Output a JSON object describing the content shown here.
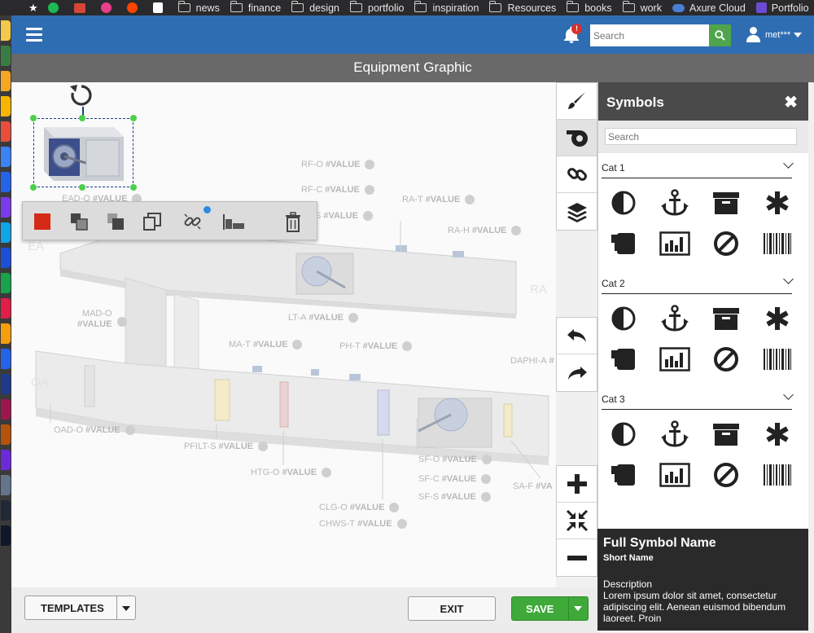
{
  "bookmarks": [
    {
      "label": "",
      "icon": "spotify-icon",
      "color": "#1db954"
    },
    {
      "label": "",
      "icon": "gmail-icon",
      "color": "#d44638"
    },
    {
      "label": "",
      "icon": "podcast-icon",
      "color": "#e83e8c"
    },
    {
      "label": "",
      "icon": "reddit-icon",
      "color": "#ff4500"
    },
    {
      "label": "",
      "icon": "instapaper-icon",
      "color": "#ffffff"
    },
    {
      "label": "news",
      "icon": "folder-icon"
    },
    {
      "label": "finance",
      "icon": "folder-icon"
    },
    {
      "label": "design",
      "icon": "folder-icon"
    },
    {
      "label": "portfolio",
      "icon": "folder-icon"
    },
    {
      "label": "inspiration",
      "icon": "folder-icon"
    },
    {
      "label": "Resources",
      "icon": "folder-icon"
    },
    {
      "label": "books",
      "icon": "folder-icon"
    },
    {
      "label": "work",
      "icon": "folder-icon"
    },
    {
      "label": "Axure Cloud",
      "icon": "cloud-icon",
      "color": "#4a7fd4"
    },
    {
      "label": "Portfolio",
      "icon": "w-icon",
      "color": "#6c4bd4"
    }
  ],
  "header": {
    "search_placeholder": "Search",
    "notification_badge": "!",
    "username": "met***",
    "accent": "#2f6db3"
  },
  "page_title": "Equipment Graphic",
  "canvas": {
    "zone_labels": [
      {
        "text": "EA"
      },
      {
        "text": "RA"
      },
      {
        "text": "OA"
      }
    ],
    "point_labels": [
      {
        "name": "RF-O",
        "value": "#VALUE"
      },
      {
        "name": "RF-C",
        "value": "#VALUE"
      },
      {
        "name": "S",
        "value": "#VALUE"
      },
      {
        "name": "RA-T",
        "value": "#VALUE"
      },
      {
        "name": "RA-H",
        "value": "#VALUE"
      },
      {
        "name": "EAD-O",
        "value": "#VALUE"
      },
      {
        "name": "MAD-O",
        "value": "#VALUE"
      },
      {
        "name": "LT-A",
        "value": "#VALUE"
      },
      {
        "name": "MA-T",
        "value": "#VALUE"
      },
      {
        "name": "PH-T",
        "value": "#VALUE"
      },
      {
        "name": "DAPHI-A",
        "value": "#"
      },
      {
        "name": "OAD-O",
        "value": "#VALUE"
      },
      {
        "name": "PFILT-S",
        "value": "#VALUE"
      },
      {
        "name": "HTG-O",
        "value": "#VALUE"
      },
      {
        "name": "SF-O",
        "value": "#VALUE"
      },
      {
        "name": "SF-C",
        "value": "#VALUE"
      },
      {
        "name": "SF-S",
        "value": "#VALUE"
      },
      {
        "name": "SA-F",
        "value": "#VA"
      },
      {
        "name": "CLG-O",
        "value": "#VALUE"
      },
      {
        "name": "CHWS-T",
        "value": "#VALUE"
      }
    ]
  },
  "element_toolbar": {
    "fill_color": "#d42a16",
    "tools": [
      "fill-color",
      "bring-forward",
      "send-backward",
      "duplicate",
      "unlink",
      "align",
      "delete"
    ]
  },
  "side_tools": [
    "brush-icon",
    "symbol-library-icon",
    "link-icon",
    "layers-icon"
  ],
  "history_tools": [
    "undo-icon",
    "redo-icon"
  ],
  "zoom_tools": [
    "zoom-in-icon",
    "fit-screen-icon",
    "zoom-out-icon"
  ],
  "symbols_panel": {
    "title": "Symbols",
    "search_placeholder": "Search",
    "categories": [
      {
        "name": "Cat 1",
        "symbols": [
          "contrast-icon",
          "anchor-icon",
          "archive-icon",
          "asterisk-icon",
          "device-icon",
          "chart-icon",
          "ban-icon",
          "barcode-icon"
        ]
      },
      {
        "name": "Cat 2",
        "symbols": [
          "contrast-icon",
          "anchor-icon",
          "archive-icon",
          "asterisk-icon",
          "device-icon",
          "chart-icon",
          "ban-icon",
          "barcode-icon"
        ]
      },
      {
        "name": "Cat 3",
        "symbols": [
          "contrast-icon",
          "anchor-icon",
          "archive-icon",
          "asterisk-icon",
          "device-icon",
          "chart-icon",
          "ban-icon",
          "barcode-icon"
        ]
      }
    ]
  },
  "symbol_detail": {
    "full_name": "Full Symbol Name",
    "short_name": "Short Name",
    "description_label": "Description",
    "description": "Lorem ipsum dolor sit amet, consectetur adipiscing elit. Aenean euismod bibendum laoreet. Proin"
  },
  "footer": {
    "templates_label": "TEMPLATES",
    "exit_label": "EXIT",
    "save_label": "SAVE",
    "save_color": "#3fa93a"
  }
}
